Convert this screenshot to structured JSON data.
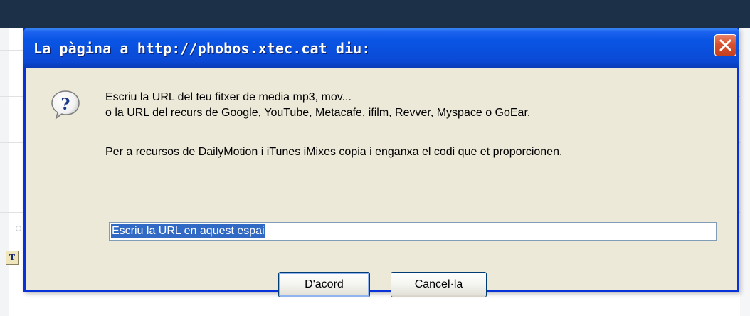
{
  "dialog": {
    "title": "La pàgina a http://phobos.xtec.cat diu:",
    "message_line1": "Escriu la URL del teu fitxer de media mp3, mov...",
    "message_line2": "o la URL del recurs de Google, YouTube, Metacafe, ifilm, Revver, Myspace o GoEar.",
    "message_line3": "Per a recursos de DailyMotion i iTunes iMixes copia i enganxa el codi que et proporcionen.",
    "input_value": "Escriu la URL en aquest espai",
    "ok_label": "D'acord",
    "cancel_label": "Cancel·la",
    "icons": {
      "close": "close-icon",
      "message": "question-icon"
    }
  },
  "background": {
    "editor_icon_glyph": "T"
  },
  "colors": {
    "titlebar": "#0a4fdc",
    "close_button": "#d8512f",
    "dialog_face": "#ece9d8",
    "selection": "#316ac5"
  }
}
